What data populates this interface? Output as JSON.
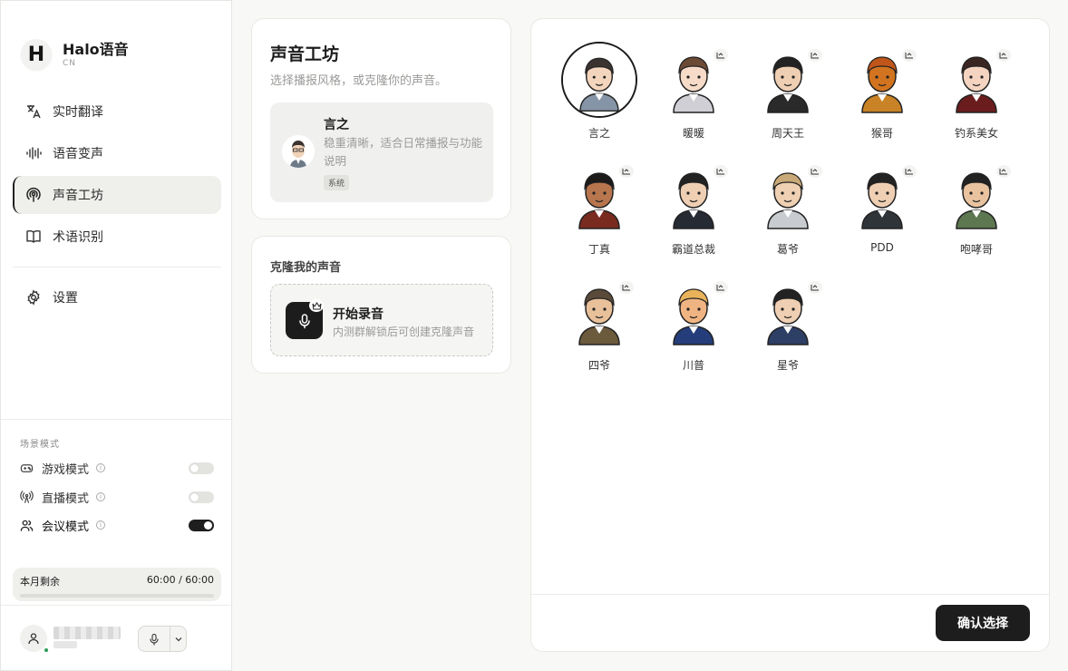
{
  "app": {
    "name": "Halo语音",
    "sub": "CN",
    "logo_letter": "H"
  },
  "nav": {
    "items": [
      {
        "label": "实时翻译",
        "icon": "translate-icon"
      },
      {
        "label": "语音变声",
        "icon": "waveform-icon"
      },
      {
        "label": "声音工坊",
        "icon": "broadcast-icon"
      },
      {
        "label": "术语识别",
        "icon": "book-icon"
      }
    ],
    "active": "声音工坊",
    "settings": "设置"
  },
  "scene": {
    "title": "场景模式",
    "modes": [
      {
        "label": "游戏模式",
        "on": false
      },
      {
        "label": "直播模式",
        "on": false
      },
      {
        "label": "会议模式",
        "on": true
      }
    ]
  },
  "quota": {
    "label": "本月剩余",
    "value": "60:00 / 60:00",
    "remaining_fraction": 1.0
  },
  "studio": {
    "title": "声音工坊",
    "subtitle": "选择播报风格，或克隆你的声音。",
    "selected": {
      "name": "言之",
      "desc": "稳重清晰，适合日常播报与功能说明",
      "badge": "系统"
    }
  },
  "clone": {
    "title": "克隆我的声音",
    "record_title": "开始录音",
    "record_sub": "内测群解锁后可创建克隆声音"
  },
  "voices": [
    {
      "name": "言之",
      "selected": true
    },
    {
      "name": "暖暖"
    },
    {
      "name": "周天王"
    },
    {
      "name": "猴哥"
    },
    {
      "name": "钓系美女"
    },
    {
      "name": "丁真"
    },
    {
      "name": "霸道总裁"
    },
    {
      "name": "葛爷"
    },
    {
      "name": "PDD"
    },
    {
      "name": "咆哮哥"
    },
    {
      "name": "四爷"
    },
    {
      "name": "川普"
    },
    {
      "name": "星爷"
    }
  ],
  "actions": {
    "confirm": "确认选择"
  },
  "colors": {
    "accent": "#1d1d1d",
    "background": "#f8f8f6",
    "online": "#2a9d55"
  }
}
